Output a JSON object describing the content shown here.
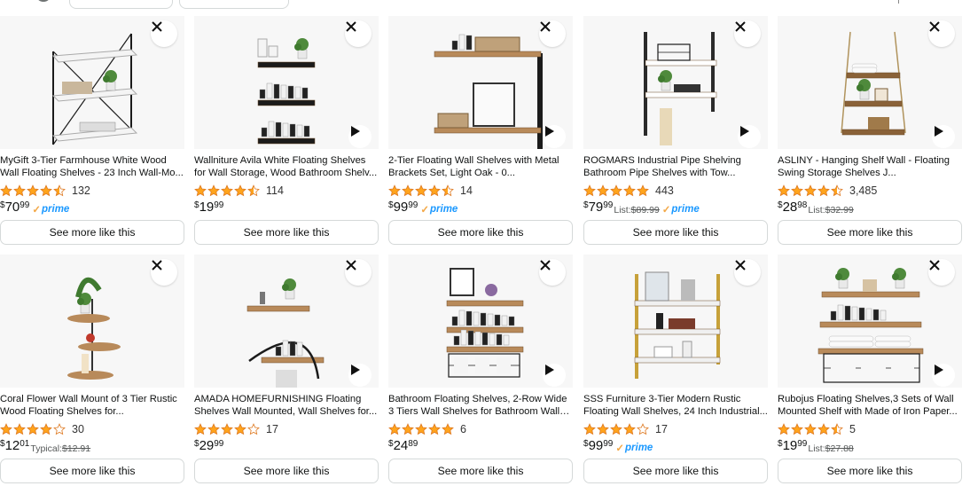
{
  "colors": {
    "star": "#ffa41c",
    "star_empty": "#ffffff",
    "prime_blue": "#1a98ff",
    "prime_check": "#f3a847"
  },
  "icons": {
    "dismiss": "close-icon",
    "video": "play-icon",
    "rating": "star-icon"
  },
  "rows": [
    [
      {
        "title": "MyGift 3-Tier Farmhouse White Wood Wall Floating Shelves - 23 Inch Wall-Mo...",
        "rating": 4.5,
        "reviews": "132",
        "price_whole": "70",
        "price_frac": "99",
        "currency": "$",
        "prime": true,
        "list_label": "",
        "list_price": "",
        "video": false,
        "button": "See more like this",
        "art": "A"
      },
      {
        "title": "Wallniture Avila White Floating Shelves for Wall Storage, Wood Bathroom Shelv...",
        "rating": 4.5,
        "reviews": "114",
        "price_whole": "19",
        "price_frac": "99",
        "currency": "$",
        "prime": false,
        "list_label": "",
        "list_price": "",
        "video": true,
        "button": "See more like this",
        "art": "B"
      },
      {
        "title": "2-Tier Floating Wall Shelves with Metal Brackets Set, Light Oak - 0...",
        "rating": 4.5,
        "reviews": "14",
        "price_whole": "99",
        "price_frac": "99",
        "currency": "$",
        "prime": true,
        "list_label": "",
        "list_price": "",
        "video": true,
        "button": "See more like this",
        "art": "C"
      },
      {
        "title": "ROGMARS Industrial Pipe Shelving Bathroom Pipe Shelves with Tow...",
        "rating": 5,
        "reviews": "443",
        "price_whole": "79",
        "price_frac": "99",
        "currency": "$",
        "prime": true,
        "list_label": "List:",
        "list_price": "$89.99",
        "video": true,
        "button": "See more like this",
        "art": "D"
      },
      {
        "title": "ASLINY - Hanging Shelf Wall - Floating Swing Storage Shelves J...",
        "rating": 4.5,
        "reviews": "3,485",
        "price_whole": "28",
        "price_frac": "98",
        "currency": "$",
        "prime": false,
        "list_label": "List:",
        "list_price": "$32.99",
        "video": true,
        "button": "See more like this",
        "art": "E"
      }
    ],
    [
      {
        "title": "Coral Flower Wall Mount of 3 Tier Rustic Wood Floating Shelves for...",
        "rating": 4,
        "reviews": "30",
        "price_whole": "12",
        "price_frac": "01",
        "currency": "$",
        "prime": false,
        "list_label": "Typical:",
        "list_price": "$12.91",
        "video": false,
        "button": "See more like this",
        "art": "F"
      },
      {
        "title": "AMADA HOMEFURNISHING Floating Shelves Wall Mounted, Wall Shelves for...",
        "rating": 4,
        "reviews": "17",
        "price_whole": "29",
        "price_frac": "99",
        "currency": "$",
        "prime": false,
        "list_label": "",
        "list_price": "",
        "video": true,
        "button": "See more like this",
        "art": "G"
      },
      {
        "title": "Bathroom Floating Shelves, 2-Row Wide 3 Tiers Wall Shelves for Bathroom Wall He...",
        "rating": 5,
        "reviews": "6",
        "price_whole": "24",
        "price_frac": "89",
        "currency": "$",
        "prime": false,
        "list_label": "",
        "list_price": "",
        "video": true,
        "button": "See more like this",
        "art": "H"
      },
      {
        "title": "SSS Furniture 3-Tier Modern Rustic Floating Wall Shelves, 24 Inch Industrial...",
        "rating": 4,
        "reviews": "17",
        "price_whole": "99",
        "price_frac": "99",
        "currency": "$",
        "prime": true,
        "list_label": "",
        "list_price": "",
        "video": false,
        "button": "See more like this",
        "art": "I"
      },
      {
        "title": "Rubojus Floating Shelves,3 Sets of Wall Mounted Shelf with Made of Iron Paper...",
        "rating": 4.5,
        "reviews": "5",
        "price_whole": "19",
        "price_frac": "99",
        "currency": "$",
        "prime": false,
        "list_label": "List:",
        "list_price": "$27.88",
        "video": true,
        "button": "See more like this",
        "art": "J"
      }
    ]
  ]
}
